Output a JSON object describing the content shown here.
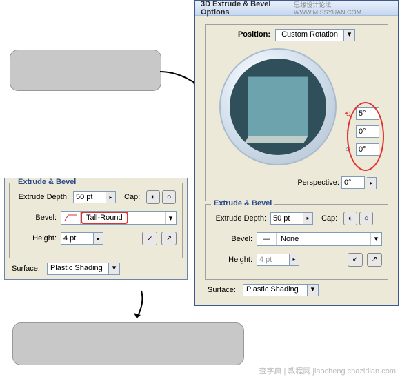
{
  "watermarks": {
    "top": "思缘设计论坛 WWW.MISSYUAN.COM",
    "bottom": "查字典 | 教程网  jiaocheng.chazidian.com"
  },
  "main": {
    "title": "3D Extrude & Bevel Options",
    "positionLabel": "Position:",
    "positionValue": "Custom Rotation",
    "rotations": [
      {
        "icon": "⟲",
        "value": "5°"
      },
      {
        "icon": "↕",
        "value": "0°"
      },
      {
        "icon": "○",
        "value": "0°"
      }
    ],
    "perspectiveLabel": "Perspective:",
    "perspectiveValue": "0°",
    "extrude": {
      "title": "Extrude & Bevel",
      "depthLabel": "Extrude Depth:",
      "depthValue": "50 pt",
      "capLabel": "Cap:",
      "bevelLabel": "Bevel:",
      "bevelValue": "None",
      "heightLabel": "Height:",
      "heightValue": "4 pt"
    },
    "surfaceLabel": "Surface:",
    "surfaceValue": "Plastic Shading"
  },
  "left": {
    "title": "Extrude & Bevel",
    "depthLabel": "Extrude Depth:",
    "depthValue": "50 pt",
    "capLabel": "Cap:",
    "bevelLabel": "Bevel:",
    "bevelValue": "Tall-Round",
    "heightLabel": "Height:",
    "heightValue": "4 pt",
    "surfaceLabel": "Surface:",
    "surfaceValue": "Plastic Shading"
  }
}
